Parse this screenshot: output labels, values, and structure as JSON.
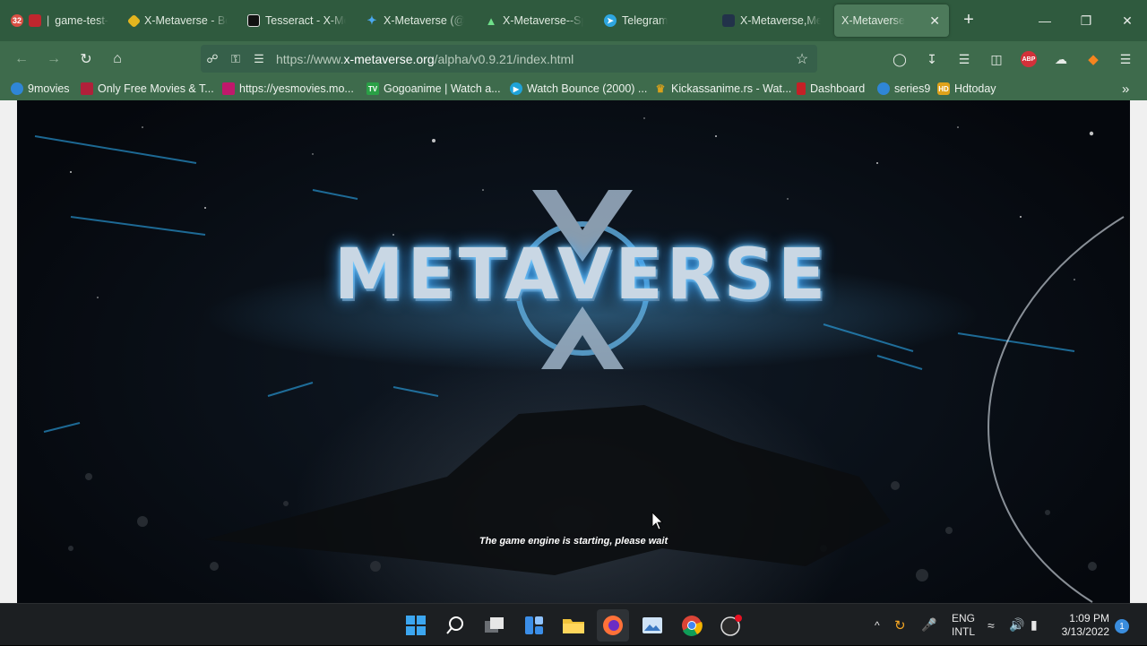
{
  "tabs": [
    {
      "label": "game-test-",
      "icon": "calendar-badge-icon"
    },
    {
      "label": "X-Metaverse - Bo",
      "icon": "binance-icon"
    },
    {
      "label": "Tesseract - X-Me",
      "icon": "tesseract-icon"
    },
    {
      "label": "X-Metaverse (@X",
      "icon": "twitter-icon"
    },
    {
      "label": "X-Metaverse--Sp",
      "icon": "spaces-icon"
    },
    {
      "label": "Telegram",
      "icon": "telegram-icon"
    },
    {
      "label": "X-Metaverse,Met",
      "icon": "xmeta-icon"
    },
    {
      "label": "X-Metaverse",
      "icon": "",
      "active": true
    }
  ],
  "tab_badge": "32",
  "url": {
    "prefix": "https://www.",
    "domain": "x-metaverse.org",
    "path": "/alpha/v0.9.21/index.html"
  },
  "bookmarks": [
    {
      "label": "9movies",
      "color": "#2f86d6"
    },
    {
      "label": "Only Free Movies & T...",
      "color": "#b0203a"
    },
    {
      "label": "https://yesmovies.mo...",
      "color": "#c0186b"
    },
    {
      "label": "Gogoanime | Watch a...",
      "color": "#2aa046"
    },
    {
      "label": "Watch Bounce (2000) ...",
      "color": "#1fa3d9"
    },
    {
      "label": "Kickassanime.rs - Wat...",
      "color": "#d8a11c"
    },
    {
      "label": "Dashboard",
      "color": "#c42026"
    },
    {
      "label": "series9",
      "color": "#2f86d6"
    },
    {
      "label": "Hdtoday",
      "color": "#e0a21a"
    }
  ],
  "toolbar": {
    "abp": "ABP"
  },
  "game": {
    "logo": "METAVERSE",
    "loading_text": "The game engine is starting, please wait"
  },
  "taskbar": {
    "language": "ENG",
    "layout": "INTL",
    "time": "1:09 PM",
    "date": "3/13/2022",
    "notifications": "1"
  },
  "colors": {
    "browser_bg": "#3e6b4c",
    "tabstrip_bg": "#2f5a3e",
    "taskbar_bg": "#1c1f22"
  }
}
